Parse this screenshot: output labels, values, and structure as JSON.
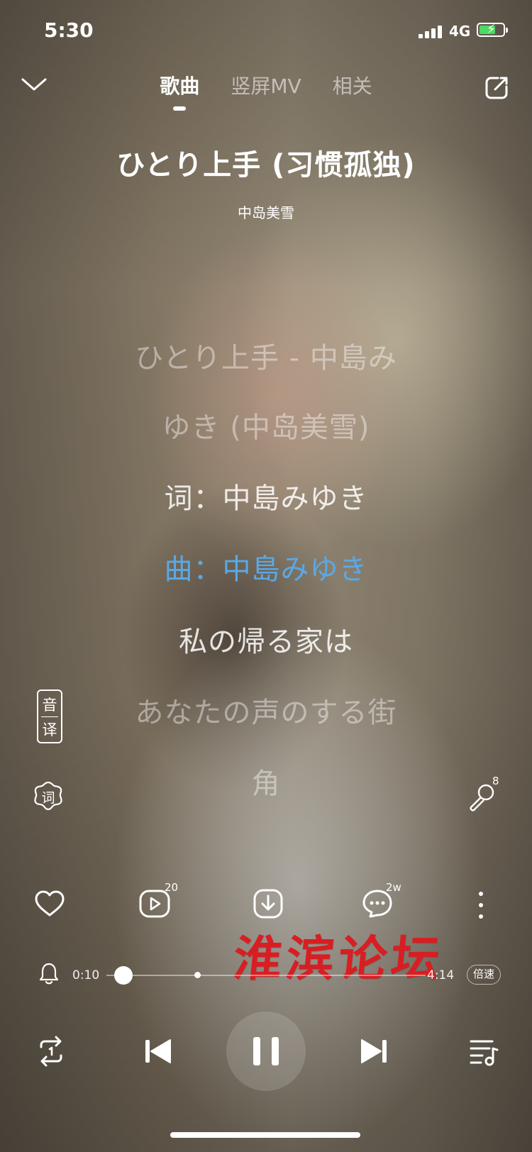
{
  "status": {
    "time": "5:30",
    "network": "4G"
  },
  "tabs": [
    {
      "label": "歌曲",
      "active": true
    },
    {
      "label": "竖屏MV",
      "active": false
    },
    {
      "label": "相关",
      "active": false
    }
  ],
  "song": {
    "title": "ひとり上手 (习惯孤独)",
    "artist": "中岛美雪"
  },
  "lyrics": [
    "ひとり上手 - 中島み",
    "ゆき (中岛美雪)",
    "词：中島みゆき",
    "曲：中島みゆき",
    "私の帰る家は",
    "あなたの声のする街",
    "角"
  ],
  "side": {
    "yin_label": "音",
    "yi_label": "译",
    "ci_label": "词",
    "mic_count": "8"
  },
  "actions": {
    "mv_count": "20",
    "comment_count": "2w"
  },
  "progress": {
    "elapsed": "0:10",
    "total": "4:14",
    "speed_label": "倍速",
    "fraction": 0.04
  },
  "watermark": "淮滨论坛",
  "colors": {
    "current_lyric": "#5aa9e6",
    "watermark": "#d81e22",
    "battery": "#4cd964"
  },
  "icons": {
    "collapse": "chevron-down-icon",
    "share": "share-icon",
    "like": "heart-icon",
    "mv": "video-play-icon",
    "download": "download-icon",
    "comment": "comment-icon",
    "more": "more-vertical-icon",
    "ringtone": "bell-icon",
    "loop": "repeat-one-icon",
    "prev": "skip-previous-icon",
    "pause": "pause-icon",
    "next": "skip-next-icon",
    "playlist": "playlist-icon",
    "karaoke": "microphone-icon"
  }
}
